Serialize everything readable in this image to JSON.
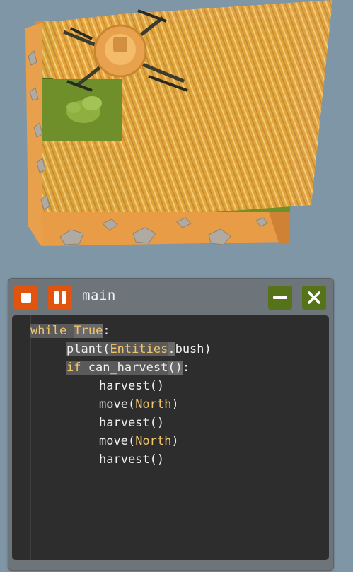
{
  "editor": {
    "title": "main",
    "buttons": {
      "stop": "stop-icon",
      "pause": "pause-icon",
      "minimize": "minimize-icon",
      "close": "close-icon"
    },
    "code": {
      "l1_kw": "while",
      "l1_val": "True",
      "l1_end": ":",
      "l2_fn": "plant",
      "l2_open": "(",
      "l2_ent": "Entities",
      "l2_dot": ".",
      "l2_attr": "bush",
      "l2_close": ")",
      "l3_kw": "if",
      "l3_fn": "can_harvest",
      "l3_paren": "()",
      "l3_end": ":",
      "l4": "harvest()",
      "l5_fn": "move(",
      "l5_arg": "North",
      "l5_close": ")",
      "l6": "harvest()",
      "l7_fn": "move(",
      "l7_arg": "North",
      "l7_close": ")",
      "l8": "harvest()"
    }
  },
  "colors": {
    "background": "#7f96a6",
    "grass": "#6f8f2a",
    "dirt_block": "#e8a04c",
    "wheat": "#f0b44a",
    "button_orange": "#e0540e",
    "button_green": "#57731a",
    "code_keyword": "#f2c469"
  },
  "scene": {
    "objects": [
      "farm-plot",
      "drone",
      "bush",
      "wheat-field",
      "rocks"
    ]
  }
}
